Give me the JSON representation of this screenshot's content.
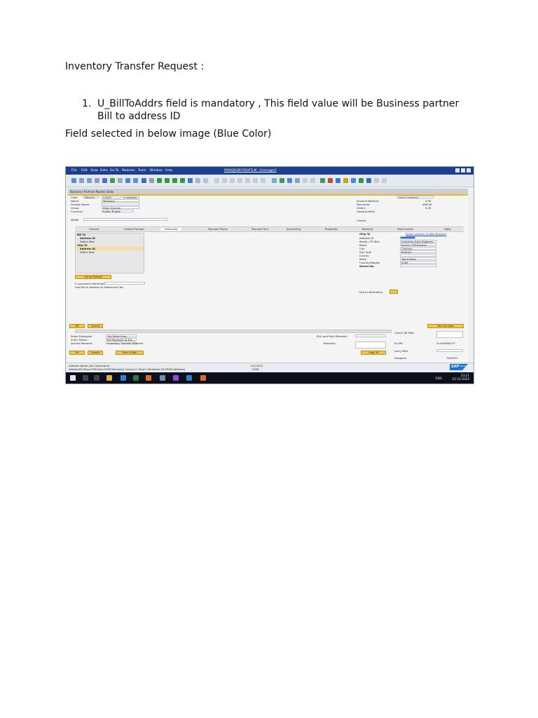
{
  "doc": {
    "heading": "Inventory Transfer Request :",
    "list_item_number": "1.",
    "list_item_text": "U_BillToAddrs field is mandatory , This field value will be Business partner Bill to address ID",
    "note": "Field selected in below image (Blue Color)"
  },
  "screenshot": {
    "menu": [
      "File",
      "Edit",
      "View",
      "Data",
      "Go To",
      "Modules",
      "Tools",
      "Window",
      "Help"
    ],
    "window_title": "PARADIGM POLYFILM - [manager]",
    "form_title": "Business Partner Master Data",
    "header_fields": {
      "code_label": "Code",
      "code_mode": "Manual",
      "code_value": "C0002",
      "type_value": "Customer",
      "name_label": "Name",
      "name_value": "Millsbury",
      "foreign_name_label": "Foreign Name",
      "group_label": "Group",
      "group_value": "Ship Che-Lee",
      "currency_label": "Currency",
      "currency_value": "Indian Rupee",
      "msme_label": "MSME"
    },
    "balance_fields": {
      "currency": "Local Currency",
      "account_balance_label": "Account Balance",
      "account_balance_value": "0.00",
      "deliveries_label": "Deliveries",
      "deliveries_value": "466.00",
      "orders_label": "Orders",
      "orders_value": "0.00",
      "opportunities_label": "Opportunities",
      "checks_label": "Checks"
    },
    "tabs": [
      "General",
      "Contact Persons",
      "Addresses",
      "Payment Terms",
      "Payment Run",
      "Accounting",
      "Properties",
      "Remarks",
      "Attachments",
      "eWay"
    ],
    "active_tab": "Addresses",
    "tree": [
      "Bill To",
      "Address ID",
      "Define New",
      "Ship To",
      "Address ID",
      "Define New"
    ],
    "set_default_button": "Set as Default",
    "ecommerce_label": "E-commerce Merchant ID",
    "use_bill_to_label": "Use Bill to Address to Determine Tax",
    "address_form": {
      "header": "Ship To",
      "show_location_link": "Show Location in Web Browser",
      "rows": [
        {
          "label": "Address ID",
          "value": ""
        },
        {
          "label": "Street / PO Box",
          "value": "Industrial Area Rajghani"
        },
        {
          "label": "Block",
          "value": "Sector 3 Pithampur"
        },
        {
          "label": "City",
          "value": "Chennai"
        },
        {
          "label": "Zip Code",
          "value": "600001"
        },
        {
          "label": "County",
          "value": ""
        },
        {
          "label": "State",
          "value": "Tamil Nadu"
        },
        {
          "label": "Country/Region",
          "value": "India"
        },
        {
          "label": "Street No.",
          "value": ""
        }
      ],
      "extra_info_label": "Extra Information"
    },
    "ok_button": "OK",
    "cancel_button": "Cancel",
    "you_can_also": "You Can Also",
    "lower_fields": {
      "sales_employee_label": "Sales Employee",
      "sales_employee_value": "-No Sales Emp-",
      "entry_status_label": "Entry Status",
      "entry_status_value": "Bill Payment of Exc",
      "journal_remarks_label": "Journal Remarks",
      "journal_remarks_value": "Inventory Transfer Request",
      "pick_pack_label": "Pick and Pack Remarks",
      "remarks_label": "Remarks",
      "check_qr_label": "Check QR Path",
      "ewb_label": "Ex-Mtr",
      "ewb_value": "01445690073",
      "approver_label": "Lorry Mfar",
      "signed_label": "Assigned",
      "signed_value": "7440571"
    },
    "lower_ok_button": "OK",
    "lower_cancel_button": "Cancel",
    "print_button": "Print & Mail",
    "copy_to_button": "Copy To",
    "status_lines": [
      "Address Name (All Characters)",
      "AddressID [Row:UOM Item:UOM Remarks] Column:1 Row:1 Variables:16 ORDS.Address]"
    ],
    "status_date": "22/12/24",
    "status_code": "0326",
    "sap_logo": "SAP",
    "sap_sub": "Business One",
    "clock_time": "23:21",
    "clock_date": "22-12-2024",
    "lang": "ENG"
  }
}
